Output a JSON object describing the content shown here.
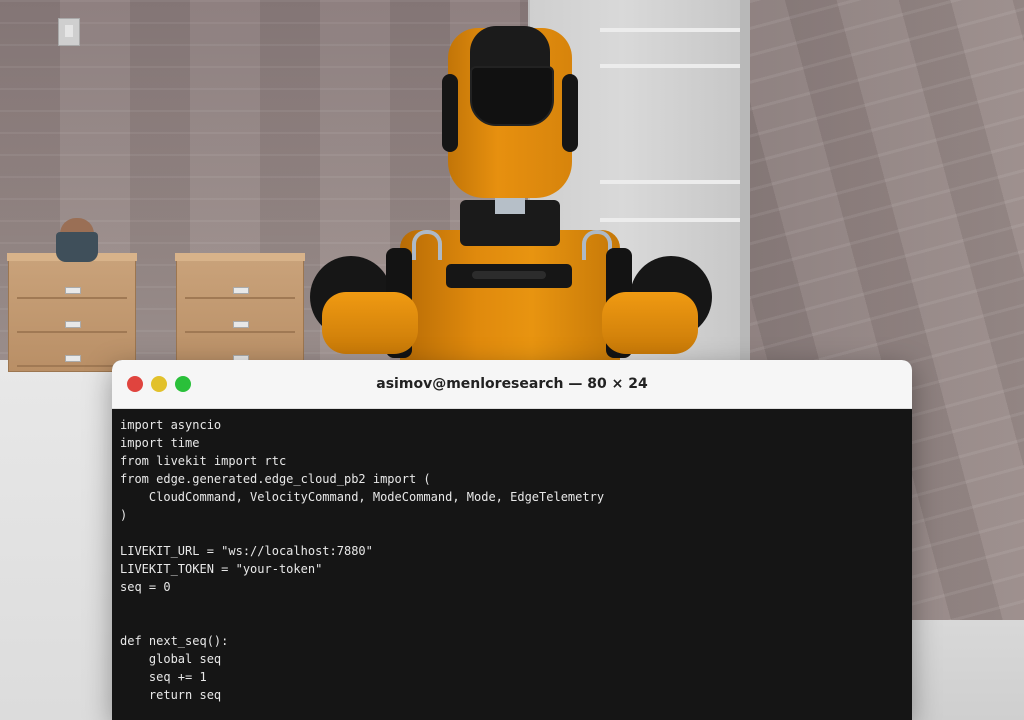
{
  "terminal": {
    "title": "asimov@menloresearch — 80 × 24",
    "controls": {
      "close_color": "#e0443e",
      "minimize_color": "#e2c12b",
      "maximize_color": "#2ac03a"
    },
    "lines": [
      "import asyncio",
      "import time",
      "from livekit import rtc",
      "from edge.generated.edge_cloud_pb2 import (",
      "    CloudCommand, VelocityCommand, ModeCommand, Mode, EdgeTelemetry",
      ")",
      "",
      "LIVEKIT_URL = \"ws://localhost:7880\"",
      "LIVEKIT_TOKEN = \"your-token\"",
      "seq = 0",
      "",
      "",
      "def next_seq():",
      "    global seq",
      "    seq += 1",
      "    return seq"
    ]
  }
}
